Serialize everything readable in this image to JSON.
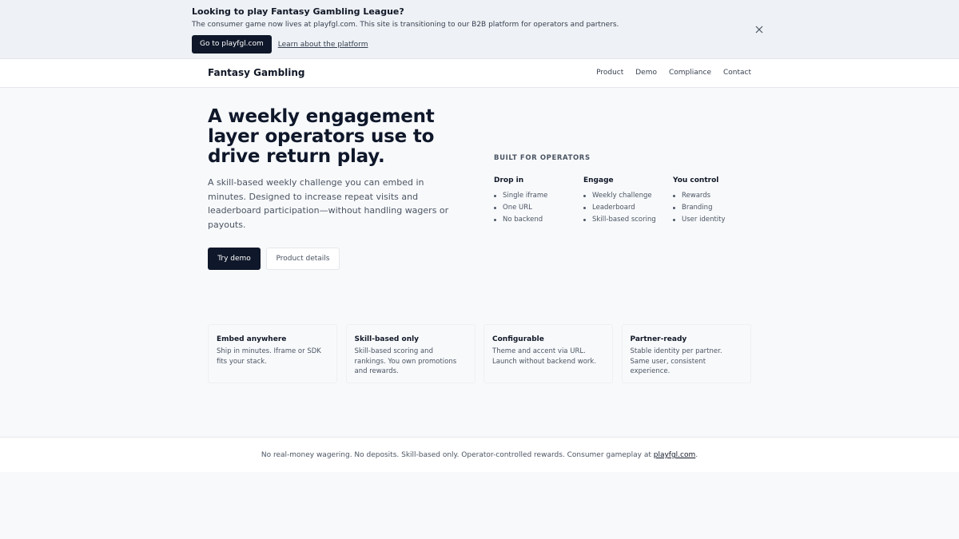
{
  "banner": {
    "title": "Looking to play Fantasy Gambling League?",
    "text": "The consumer game now lives at playfgl.com. This site is transitioning to our B2B platform for operators and partners.",
    "primary_button": "Go to playfgl.com",
    "link": "Learn about the platform",
    "close_icon": "close-icon"
  },
  "nav": {
    "brand": "Fantasy Gambling",
    "links": [
      "Product",
      "Demo",
      "Compliance",
      "Contact"
    ]
  },
  "hero": {
    "title": "A weekly engagement layer operators use to drive return play.",
    "subtitle": "A skill-based weekly challenge you can embed in minutes. Designed to increase repeat visits and leaderboard participation—without handling wagers or payouts.",
    "primary_button": "Try demo",
    "secondary_button": "Product details"
  },
  "operators": {
    "heading": "BUILT FOR OPERATORS",
    "columns": [
      {
        "title": "Drop in",
        "items": [
          "Single iframe",
          "One URL",
          "No backend"
        ]
      },
      {
        "title": "Engage",
        "items": [
          "Weekly challenge",
          "Leaderboard",
          "Skill-based scoring"
        ]
      },
      {
        "title": "You control",
        "items": [
          "Rewards",
          "Branding",
          "User identity"
        ]
      }
    ]
  },
  "features": [
    {
      "title": "Embed anywhere",
      "text": "Ship in minutes. Iframe or SDK fits your stack."
    },
    {
      "title": "Skill-based only",
      "text": "Skill-based scoring and rankings. You own promotions and rewards."
    },
    {
      "title": "Configurable",
      "text": "Theme and accent via URL. Launch without backend work."
    },
    {
      "title": "Partner-ready",
      "text": "Stable identity per partner. Same user, consistent experience."
    }
  ],
  "footer": {
    "text": "No real-money wagering. No deposits. Skill-based only. Operator-controlled rewards. Consumer gameplay at ",
    "link": "playfgl.com",
    "suffix": "."
  },
  "colors": {
    "primary": "#0f172a",
    "banner_bg": "#eef1f5",
    "page_bg": "#f8f9fb"
  }
}
